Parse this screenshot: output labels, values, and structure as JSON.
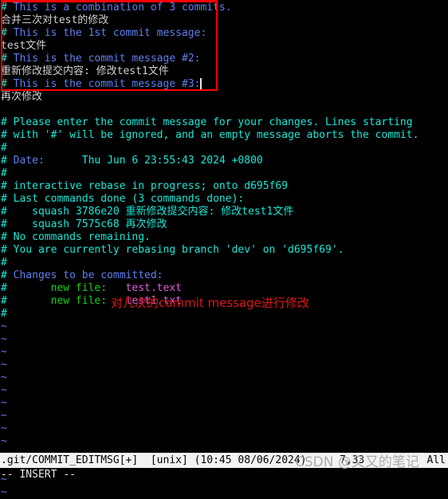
{
  "editor": {
    "name": "vim",
    "mode_label": "-- INSERT --",
    "cursor_glyph": "",
    "status": {
      "file": ".git/COMMIT_EDITMSG[+]  [unix] (10:45 08/06/2024)",
      "position": "7,33          All"
    }
  },
  "colors": {
    "background": "#000000",
    "comment_blue": "#5f7fee",
    "comment_cyan": "#18e8d8",
    "user_text": "#d0d0d0",
    "green": "#19d219",
    "magenta": "#e35ce0",
    "tilde": "#5f7fee",
    "annotation_red": "#e01414",
    "box_red": "#fb0000",
    "statusbar_bg": "#f2f2f2",
    "statusbar_fg": "#000000"
  },
  "annotation": {
    "caption": "对几次的commit message进行修改",
    "box_label": "commit-message-edit-region"
  },
  "watermark": {
    "text": "CSDN @又又的笔记"
  },
  "buffer": {
    "lines": [
      {
        "id": "l1",
        "hash": "# ",
        "body": "This is a combination of 3 commits.",
        "style": "c-comment"
      },
      {
        "id": "l2",
        "hash": "",
        "body": "合并三次对test的修改",
        "style": "c-text"
      },
      {
        "id": "l3",
        "hash": "# ",
        "body": "This is the 1st commit message:",
        "style": "c-comment"
      },
      {
        "id": "l4",
        "hash": "",
        "body": "test文件",
        "style": "c-text"
      },
      {
        "id": "l5",
        "hash": "# ",
        "body": "This is the commit message #2:",
        "style": "c-comment"
      },
      {
        "id": "l6",
        "hash": "",
        "body": "重新修改提交内容: 修改test1文件",
        "style": "c-text"
      },
      {
        "id": "l7",
        "hash": "# ",
        "body": "This is the commit message #3:",
        "style": "c-comment",
        "cursor": true
      },
      {
        "id": "l8",
        "hash": "",
        "body": "再次修改",
        "style": "c-text"
      },
      {
        "id": "l9",
        "hash": "",
        "body": "",
        "style": "c-text"
      },
      {
        "id": "l10",
        "hash": "# ",
        "body": "Please enter the commit message for your changes. Lines starting",
        "style": "c-cyan"
      },
      {
        "id": "l11",
        "hash": "# ",
        "body": "with '#' will be ignored, and an empty message aborts the commit.",
        "style": "c-cyan"
      },
      {
        "id": "l12",
        "hash": "#",
        "body": "",
        "style": "c-cyan"
      },
      {
        "id": "l13",
        "hash": "# ",
        "body": "Date:      Thu Jun 6 23:55:43 2024 +0800",
        "style": "c-comment",
        "split_at": 7,
        "tail_style": "c-cyan"
      },
      {
        "id": "l14",
        "hash": "#",
        "body": "",
        "style": "c-cyan"
      },
      {
        "id": "l15",
        "hash": "# ",
        "body": "interactive rebase in progress; onto d695f69",
        "style": "c-cyan"
      },
      {
        "id": "l16",
        "hash": "# ",
        "body": "Last commands done (3 commands done):",
        "style": "c-cyan"
      },
      {
        "id": "l17",
        "hash": "# ",
        "body": "   squash 3786e20 重新修改提交内容: 修改test1文件",
        "style": "c-cyan"
      },
      {
        "id": "l18",
        "hash": "# ",
        "body": "   squash 7575c68 再次修改",
        "style": "c-cyan"
      },
      {
        "id": "l19",
        "hash": "# ",
        "body": "No commands remaining.",
        "style": "c-cyan"
      },
      {
        "id": "l20",
        "hash": "# ",
        "body": "You are currently rebasing branch 'dev' on 'd695f69'.",
        "style": "c-cyan"
      },
      {
        "id": "l21",
        "hash": "#",
        "body": "",
        "style": "c-cyan"
      },
      {
        "id": "l22",
        "hash": "# ",
        "body": "Changes to be committed:",
        "style": "c-comment"
      },
      {
        "id": "l23",
        "hash": "# ",
        "body": "      new file:   test.text",
        "style": "c-green",
        "file": "test.text",
        "label": "      new file:   "
      },
      {
        "id": "l24",
        "hash": "# ",
        "body": "      new file:   test1.txt",
        "style": "c-green",
        "file": "test1.txt",
        "label": "      new file:   "
      },
      {
        "id": "l25",
        "hash": "#",
        "body": "",
        "style": "c-cyan"
      }
    ],
    "empty_marker": "~",
    "empty_count": 14
  }
}
